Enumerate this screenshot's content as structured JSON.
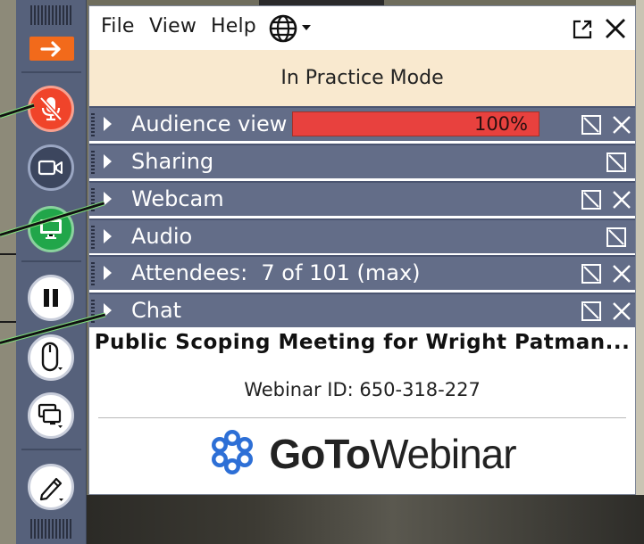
{
  "menu": {
    "file": "File",
    "view": "View",
    "help": "Help",
    "language_icon": "globe-icon",
    "popout_icon": "popout-icon",
    "close_icon": "close-icon"
  },
  "banner": {
    "text": "In Practice Mode"
  },
  "sections": [
    {
      "label": "Audience view",
      "actions": [
        "popout-icon",
        "close-icon"
      ],
      "progress_text": "100%",
      "progress_value": 1.0
    },
    {
      "label": "Sharing",
      "actions": [
        "popout-icon"
      ]
    },
    {
      "label": "Webcam",
      "actions": [
        "popout-icon",
        "close-icon"
      ]
    },
    {
      "label": "Audio",
      "actions": [
        "popout-icon"
      ]
    },
    {
      "label": "Attendees:  7 of 101 (max)",
      "actions": [
        "popout-icon",
        "close-icon"
      ]
    },
    {
      "label": "Chat",
      "actions": [
        "popout-icon",
        "close-icon"
      ]
    }
  ],
  "meeting": {
    "title": "Public Scoping Meeting for Wright Patman...",
    "webinar_id": "Webinar ID: 650-318-227"
  },
  "brand": {
    "bold": "GoTo",
    "light": "Webinar",
    "icon": "gotowebinar-logo-icon"
  },
  "control_strip": {
    "buttons": [
      "collapse-arrow-icon",
      "muted-mic-icon",
      "webcam-icon",
      "screen-share-icon",
      "pause-icon",
      "mouse-icon",
      "monitors-icon",
      "pen-icon"
    ]
  },
  "colors": {
    "strip": "#56617b",
    "row": "#636d88",
    "banner": "#f9e9cf",
    "orange": "#f26a1b",
    "mic_red": "#f0442a",
    "screen_green": "#21a64a",
    "progress_red": "#e8413e",
    "logo_blue": "#2d6fd6"
  }
}
